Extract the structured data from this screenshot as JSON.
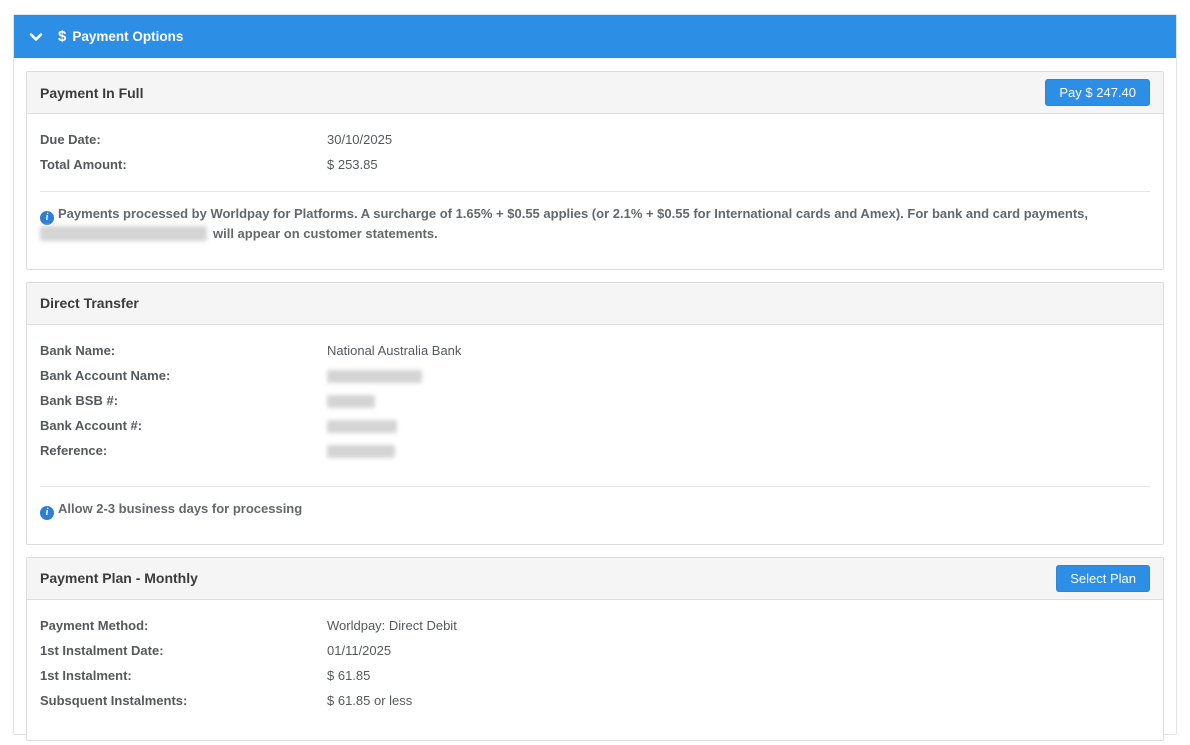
{
  "colors": {
    "accent_blue": "#2d8ee6",
    "panel_header_bg": "#f5f5f5",
    "border_gray": "#dddddd",
    "info_icon_blue": "#2d7fd3"
  },
  "header": {
    "title": "Payment Options",
    "dollar_icon": "$"
  },
  "payment_in_full": {
    "title": "Payment In Full",
    "pay_button": "Pay $ 247.40",
    "rows": [
      {
        "label": "Due Date:",
        "value": "30/10/2025"
      },
      {
        "label": "Total Amount:",
        "value": "$ 253.85"
      }
    ],
    "note_before": "Payments processed by Worldpay for Platforms. A surcharge of 1.65% + $0.55 applies (or 2.1% + $0.55 for International cards and Amex). For bank and card payments,",
    "note_after": "will appear on customer statements."
  },
  "direct_transfer": {
    "title": "Direct Transfer",
    "rows": [
      {
        "label": "Bank Name:",
        "value": "National Australia Bank"
      },
      {
        "label": "Bank Account Name:",
        "value": ""
      },
      {
        "label": "Bank BSB #:",
        "value": ""
      },
      {
        "label": "Bank Account #:",
        "value": ""
      },
      {
        "label": "Reference:",
        "value": ""
      }
    ],
    "note": "Allow 2-3 business days for processing"
  },
  "payment_plan": {
    "title": "Payment Plan - Monthly",
    "select_button": "Select Plan",
    "rows": [
      {
        "label": "Payment Method:",
        "value": "Worldpay: Direct Debit"
      },
      {
        "label": "1st Instalment Date:",
        "value": "01/11/2025"
      },
      {
        "label": "1st Instalment:",
        "value": "$ 61.85"
      },
      {
        "label": "Subsquent Instalments:",
        "value": "$ 61.85 or less"
      }
    ]
  }
}
